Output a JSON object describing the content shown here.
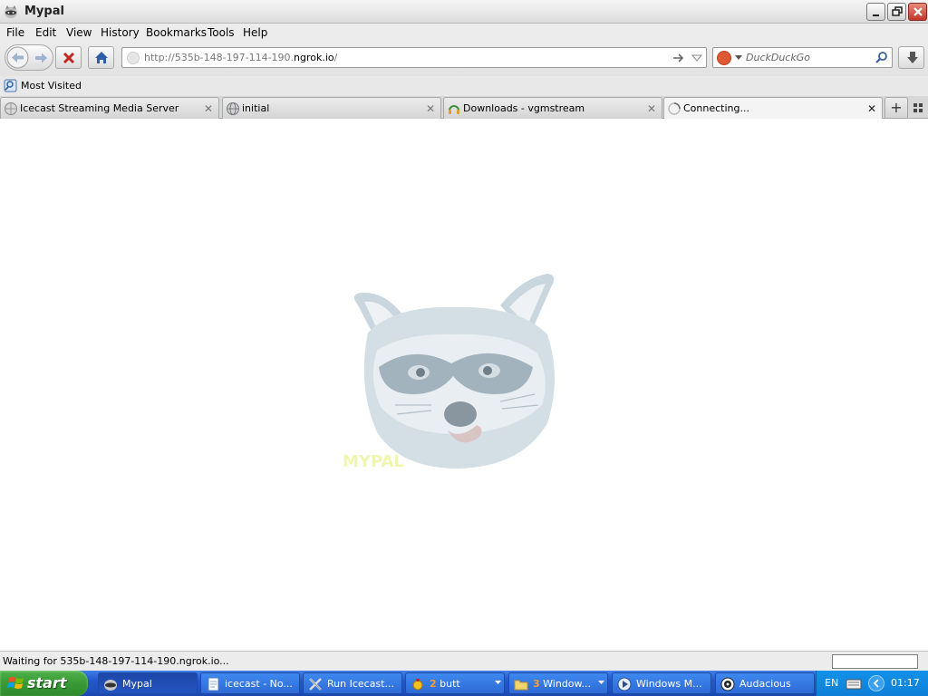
{
  "window": {
    "title": "Mypal"
  },
  "menu": [
    "File",
    "Edit",
    "View",
    "History",
    "Bookmarks",
    "Tools",
    "Help"
  ],
  "navbar": {
    "url_prefix": "http://535b-148-197-114-190.",
    "url_domain": "ngrok.io",
    "url_suffix": "/",
    "search_placeholder": "DuckDuckGo"
  },
  "bookmarks": {
    "most_visited": "Most Visited"
  },
  "tabs": [
    {
      "label": "Icecast Streaming Media Server",
      "icon": "page-icon"
    },
    {
      "label": "initial",
      "icon": "globe-icon"
    },
    {
      "label": "Downloads - vgmstream",
      "icon": "headphones-icon"
    },
    {
      "label": "Connecting...",
      "icon": "loading-icon"
    }
  ],
  "content": {
    "logo_text": "MYPAL"
  },
  "status": {
    "text": "Waiting for 535b-148-197-114-190.ngrok.io..."
  },
  "taskbar": {
    "start": "start",
    "items": [
      {
        "label": "Mypal",
        "icon": "mypal-icon"
      },
      {
        "label": "icecast - No...",
        "icon": "notepad-icon"
      },
      {
        "label": "Run Icecast...",
        "icon": "icecast-icon"
      },
      {
        "count": "2",
        "label": "butt",
        "icon": "butt-icon"
      },
      {
        "count": "3",
        "label": "Window...",
        "icon": "folder-icon"
      },
      {
        "label": "Windows M...",
        "icon": "media-player-icon"
      },
      {
        "label": "Audacious",
        "icon": "audacious-icon"
      }
    ],
    "tray": {
      "lang": "EN",
      "clock": "01:17"
    }
  },
  "colors": {
    "taskbar": "#245edb",
    "start": "#3a9a36",
    "tray": "#0f8ae0"
  }
}
